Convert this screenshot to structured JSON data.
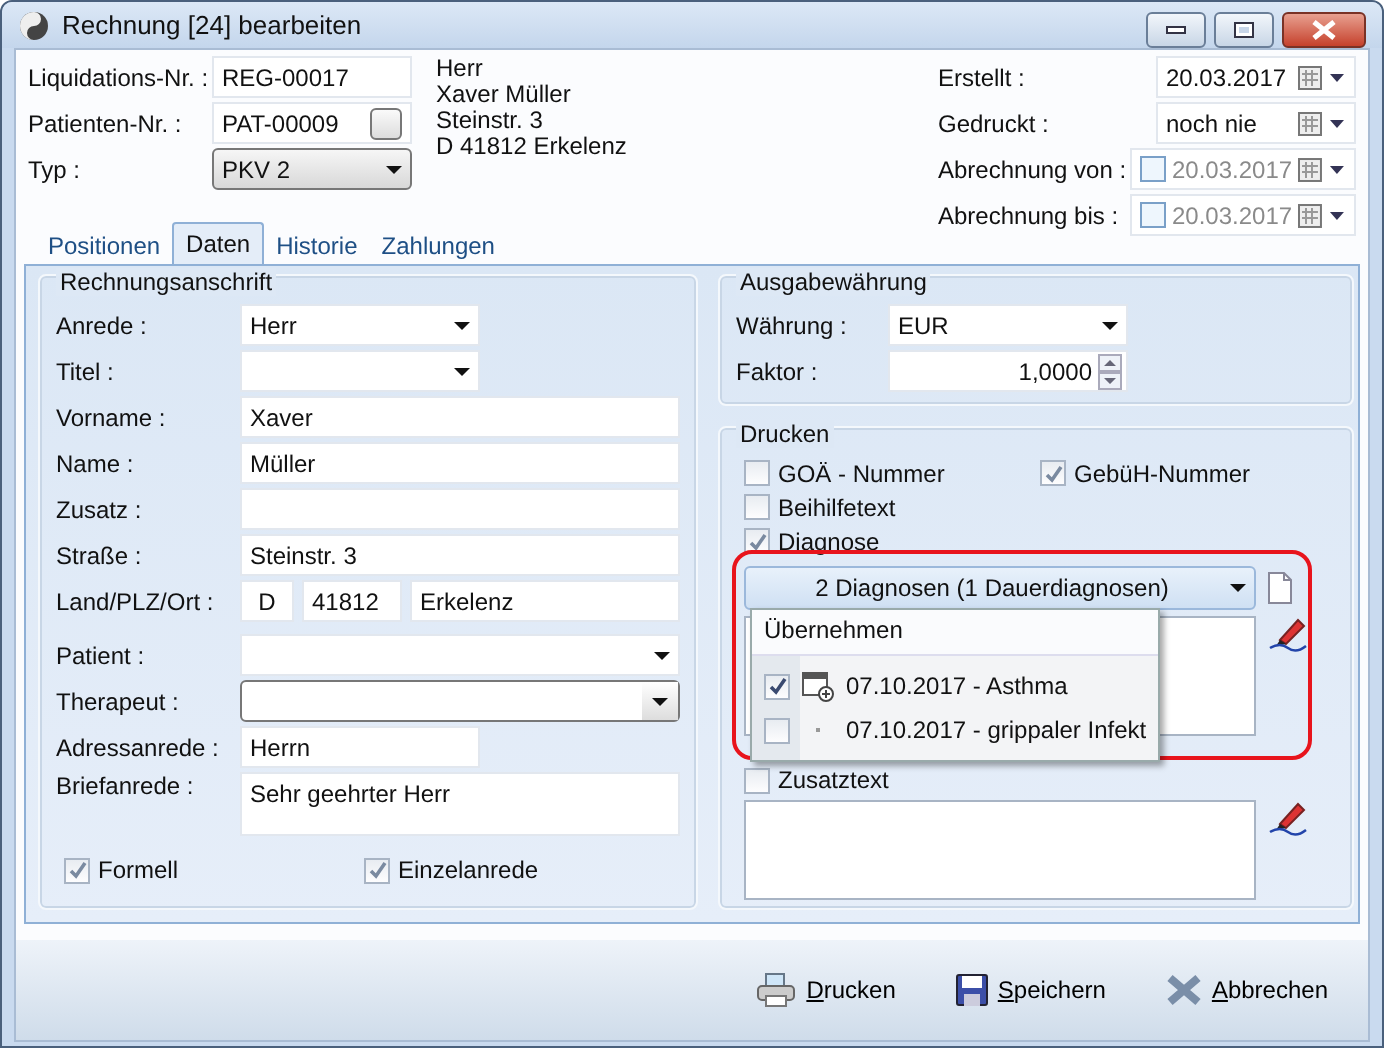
{
  "window": {
    "title": "Rechnung [24] bearbeiten"
  },
  "header": {
    "left_fields": [
      {
        "label": "Liquidations-Nr. :",
        "value": "REG-00017",
        "kind": "text"
      },
      {
        "label": "Patienten-Nr. :",
        "value": "PAT-00009",
        "kind": "lookup"
      },
      {
        "label": "Typ :",
        "value": "PKV 2",
        "kind": "select"
      }
    ],
    "address_lines": [
      "Herr",
      "Xaver Müller",
      "Steinstr. 3",
      "D 41812 Erkelenz"
    ],
    "right_fields": [
      {
        "label": "Erstellt :",
        "value": "20.03.2017",
        "kind": "date"
      },
      {
        "label": "Gedruckt :",
        "value": "noch nie",
        "kind": "date"
      },
      {
        "label": "Abrechnung von :",
        "value": "20.03.2017",
        "kind": "optional_date",
        "checked": false
      },
      {
        "label": "Abrechnung bis :",
        "value": "20.03.2017",
        "kind": "optional_date",
        "checked": false
      }
    ]
  },
  "tabs": [
    {
      "label": "Positionen",
      "selected": false
    },
    {
      "label": "Daten",
      "selected": true
    },
    {
      "label": "Historie",
      "selected": false
    },
    {
      "label": "Zahlungen",
      "selected": false
    }
  ],
  "billing_address": {
    "title": "Rechnungsanschrift",
    "fields": [
      {
        "label": "Anrede :",
        "value": "Herr",
        "kind": "select"
      },
      {
        "label": "Titel :",
        "kind": "select"
      },
      {
        "label": "Vorname :",
        "value": "Xaver",
        "kind": "text"
      },
      {
        "label": "Name :",
        "value": "Müller",
        "kind": "text"
      },
      {
        "label": "Zusatz :",
        "kind": "text"
      },
      {
        "label": "Straße :",
        "value": "Steinstr. 3",
        "kind": "text"
      },
      {
        "label": "Land/PLZ/Ort :",
        "values": [
          "D",
          "41812",
          "Erkelenz"
        ],
        "kind": "triple"
      },
      {
        "label": "Patient :",
        "kind": "wide_select"
      },
      {
        "label": "Therapeut :",
        "kind": "combo"
      },
      {
        "label": "Adressanrede :",
        "value": "Herrn",
        "kind": "short_text"
      },
      {
        "label": "Briefanrede :",
        "value": "Sehr geehrter Herr",
        "kind": "textarea"
      }
    ],
    "checkboxes": [
      {
        "label": "Formell",
        "checked": true
      },
      {
        "label": "Einzelanrede",
        "checked": true
      }
    ]
  },
  "currency": {
    "title": "Ausgabewährung",
    "fields": [
      {
        "label": "Währung :",
        "value": "EUR",
        "kind": "select"
      },
      {
        "label": "Faktor :",
        "value": "1,0000",
        "kind": "spin"
      }
    ]
  },
  "print": {
    "title": "Drucken",
    "option_rows": [
      [
        {
          "label": "GOÄ - Nummer",
          "checked": false
        },
        {
          "label": "GebüH-Nummer",
          "checked": true
        }
      ],
      [
        {
          "label": "Beihilfetext",
          "checked": false
        }
      ],
      [
        {
          "label": "Diagnose",
          "checked": true
        }
      ]
    ],
    "diagnosis_dropdown": {
      "value": "2 Diagnosen (1 Dauerdiagnosen)",
      "expanded": true
    },
    "popup": {
      "header": "Übernehmen",
      "items": [
        {
          "label": "07.10.2017 - Asthma",
          "checked": true,
          "permanent": true
        },
        {
          "label": "07.10.2017 - grippaler Infekt",
          "checked": false,
          "permanent": false
        }
      ]
    },
    "additional": {
      "label": "Zusatztext",
      "checked": false
    }
  },
  "buttons": [
    {
      "label": "Drucken",
      "kind": "print"
    },
    {
      "label": "Speichern",
      "kind": "save"
    },
    {
      "label": "Abbrechen",
      "kind": "cancel"
    }
  ]
}
